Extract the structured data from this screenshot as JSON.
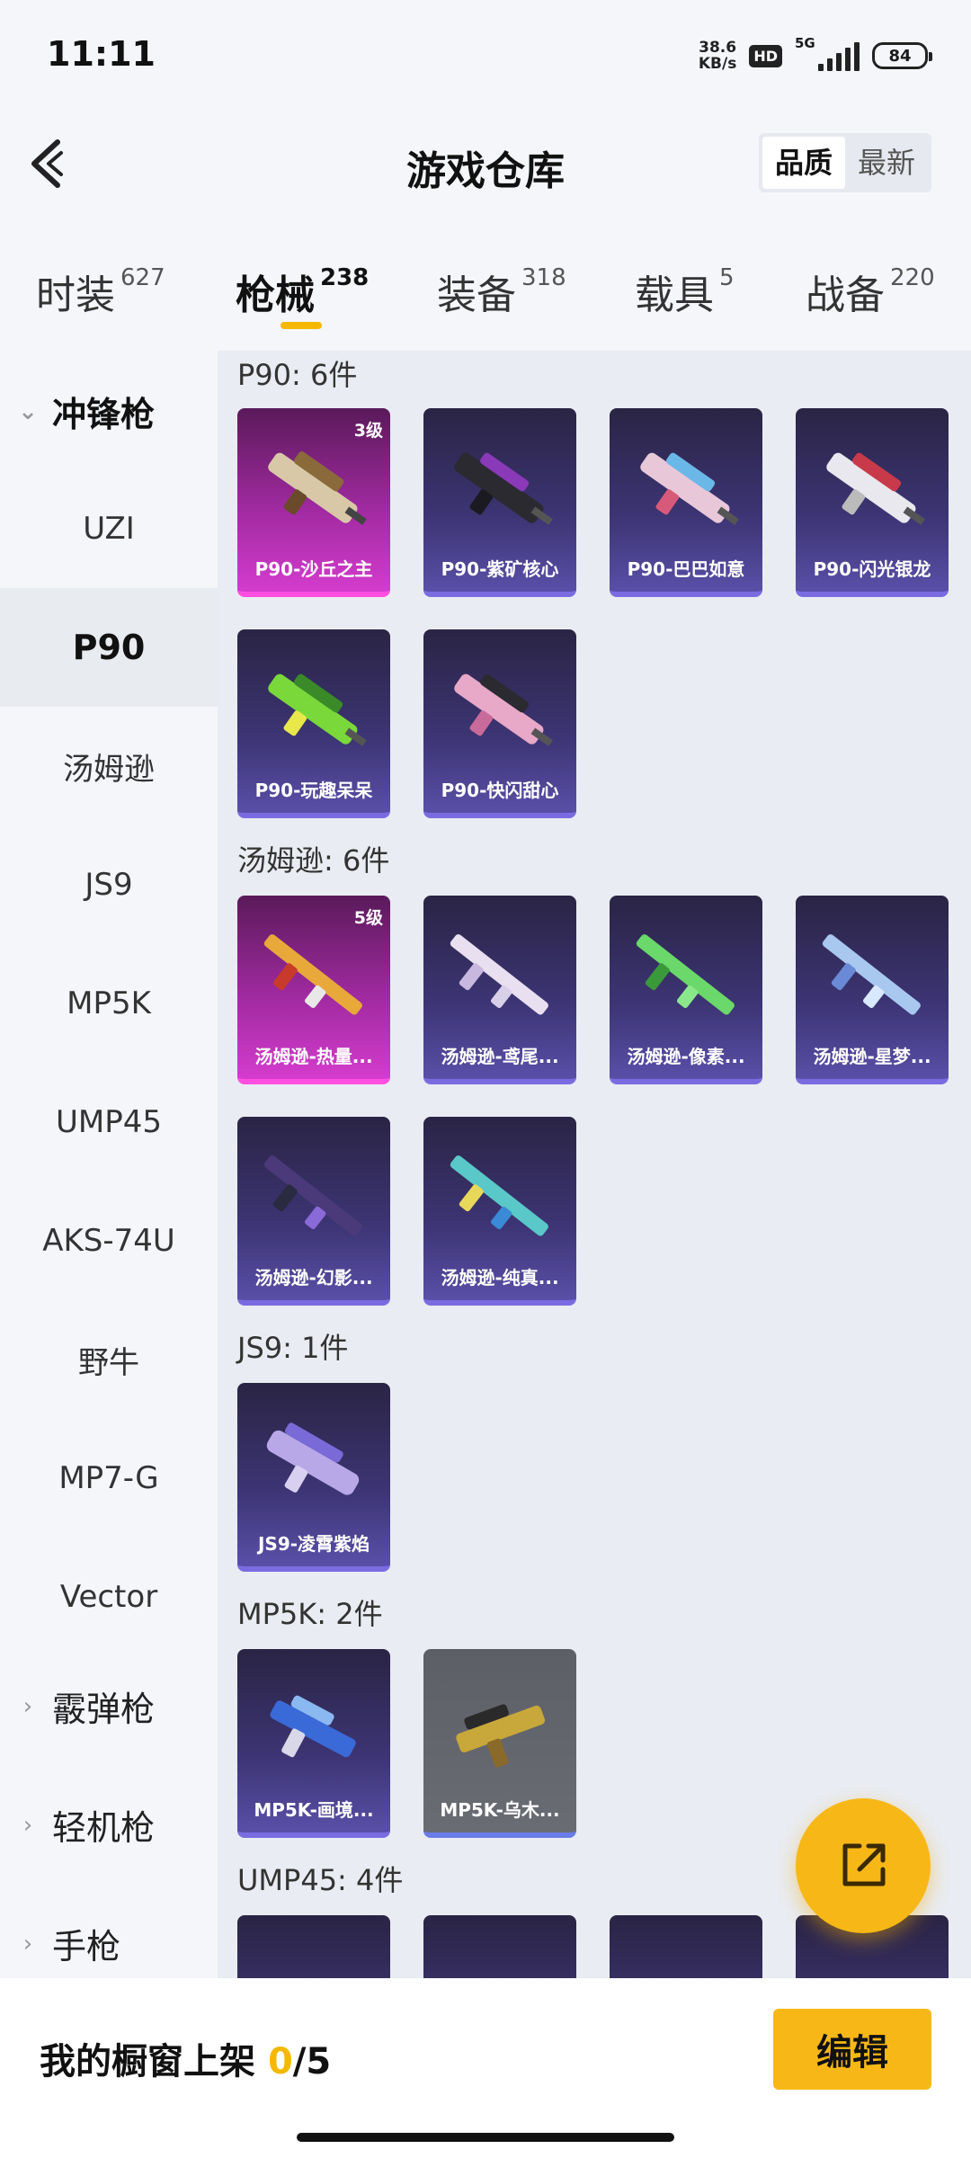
{
  "status_bar": {
    "time": "11:11",
    "speed_value": "38.6",
    "speed_unit": "KB/s",
    "hd": "HD",
    "network": "5G",
    "battery": "84"
  },
  "header": {
    "title": "游戏仓库",
    "sort_options": [
      "品质",
      "最新"
    ],
    "sort_active": "品质"
  },
  "tabs": [
    {
      "label": "时装",
      "count": "627"
    },
    {
      "label": "枪械",
      "count": "238",
      "active": true
    },
    {
      "label": "装备",
      "count": "318"
    },
    {
      "label": "载具",
      "count": "5"
    },
    {
      "label": "战备",
      "count": "220"
    }
  ],
  "sidebar": {
    "group_open": "冲锋枪",
    "items": [
      "UZI",
      "P90",
      "汤姆逊",
      "JS9",
      "MP5K",
      "UMP45",
      "AKS-74U",
      "野牛",
      "MP7-G",
      "Vector"
    ],
    "active": "P90",
    "groups_collapsed": [
      "霰弹枪",
      "轻机枪",
      "手枪"
    ]
  },
  "sections": [
    {
      "title": "P90: 6件",
      "items": [
        {
          "name": "P90-沙丘之主",
          "level": "3级",
          "rarity": "pink"
        },
        {
          "name": "P90-紫矿核心",
          "rarity": "purple"
        },
        {
          "name": "P90-巴巴如意",
          "rarity": "purple"
        },
        {
          "name": "P90-闪光银龙",
          "rarity": "purple"
        },
        {
          "name": "P90-玩趣呆呆",
          "rarity": "purple"
        },
        {
          "name": "P90-快闪甜心",
          "rarity": "purple"
        }
      ]
    },
    {
      "title": "汤姆逊: 6件",
      "items": [
        {
          "name": "汤姆逊-热量...",
          "level": "5级",
          "rarity": "pink"
        },
        {
          "name": "汤姆逊-鸢尾...",
          "rarity": "purple"
        },
        {
          "name": "汤姆逊-像素...",
          "rarity": "purple"
        },
        {
          "name": "汤姆逊-星梦...",
          "rarity": "purple"
        },
        {
          "name": "汤姆逊-幻影...",
          "rarity": "purple"
        },
        {
          "name": "汤姆逊-纯真...",
          "rarity": "purple"
        }
      ]
    },
    {
      "title": "JS9: 1件",
      "items": [
        {
          "name": "JS9-凌霄紫焰",
          "rarity": "purple"
        }
      ]
    },
    {
      "title": "MP5K: 2件",
      "items": [
        {
          "name": "MP5K-画境...",
          "rarity": "purple"
        },
        {
          "name": "MP5K-乌木...",
          "rarity": "grey"
        }
      ]
    },
    {
      "title": "UMP45: 4件",
      "items": []
    }
  ],
  "bottom": {
    "label_prefix": "我的橱窗上架",
    "count_current": "0",
    "count_sep": "/",
    "count_total": "5",
    "edit_label": "编辑"
  },
  "colors": {
    "accent": "#f7b817",
    "purple_card": "#3d3575",
    "pink_card": "#a02aa0"
  }
}
